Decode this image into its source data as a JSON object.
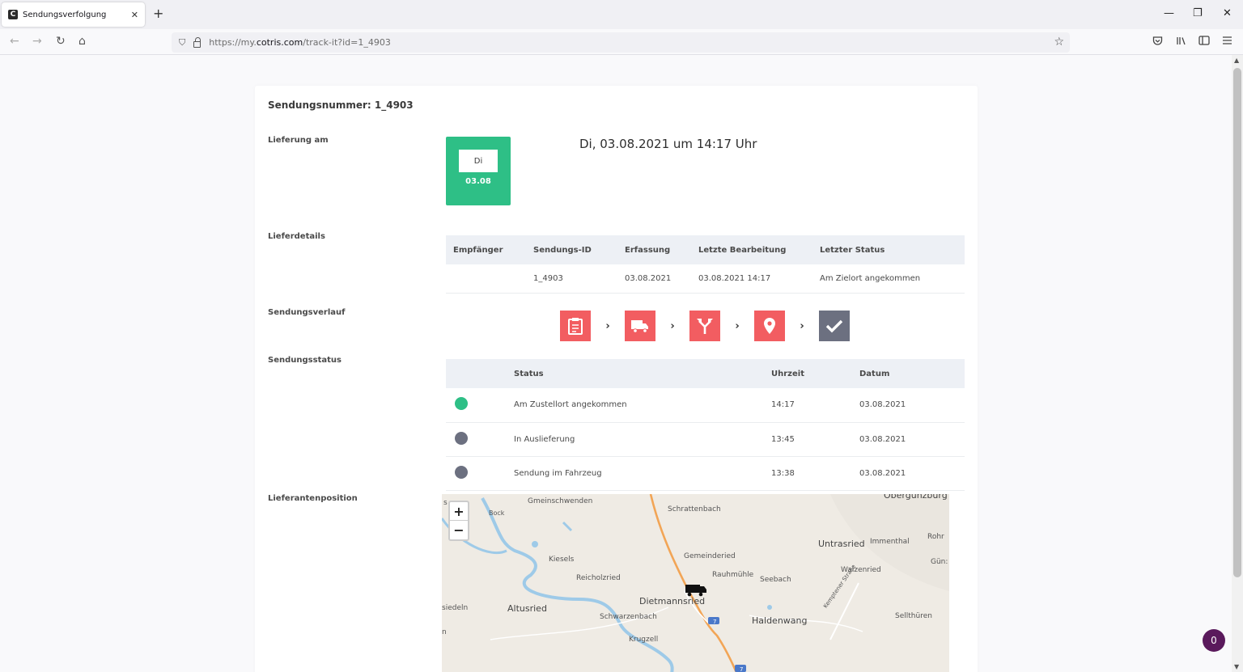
{
  "browser": {
    "tab_title": "Sendungsverfolgung",
    "tab_close": "✕",
    "new_tab": "+",
    "url_prefix": "https://my.",
    "url_domain": "cotris.com",
    "url_path": "/track-it?id=1_4903",
    "window_controls": {
      "minimize": "—",
      "restore": "❐",
      "close": "✕"
    },
    "nav": {
      "back": "←",
      "forward": "→",
      "reload": "↻",
      "home": "⌂"
    }
  },
  "page": {
    "heading_label": "Sendungsnummer:",
    "shipment_number": "1_4903",
    "delivery": {
      "label": "Lieferung am",
      "day_short": "Di",
      "date_short": "03.08",
      "full_text": "Di, 03.08.2021 um 14:17 Uhr"
    },
    "details": {
      "label": "Lieferdetails",
      "columns": [
        "Empfänger",
        "Sendungs-ID",
        "Erfassung",
        "Letzte Bearbeitung",
        "Letzter Status"
      ],
      "row": [
        "",
        "1_4903",
        "03.08.2021",
        "03.08.2021 14:17",
        "Am Zielort angekommen"
      ]
    },
    "history": {
      "label": "Sendungsverlauf",
      "steps": [
        {
          "icon": "clipboard-icon",
          "state": "done"
        },
        {
          "icon": "truck-icon",
          "state": "done"
        },
        {
          "icon": "route-split-icon",
          "state": "done"
        },
        {
          "icon": "location-pin-icon",
          "state": "done"
        },
        {
          "icon": "checkmark-icon",
          "state": "pending"
        }
      ],
      "arrow": "›"
    },
    "status": {
      "label": "Sendungsstatus",
      "columns": [
        "",
        "Status",
        "Uhrzeit",
        "Datum"
      ],
      "rows": [
        {
          "color": "#2ebf86",
          "status": "Am Zustellort angekommen",
          "time": "14:17",
          "date": "03.08.2021"
        },
        {
          "color": "#6c7080",
          "status": "In Auslieferung",
          "time": "13:45",
          "date": "03.08.2021"
        },
        {
          "color": "#6c7080",
          "status": "Sendung im Fahrzeug",
          "time": "13:38",
          "date": "03.08.2021"
        }
      ]
    },
    "position": {
      "label": "Lieferantenposition",
      "zoom_in": "+",
      "zoom_out": "−",
      "places": {
        "gmeinschwenden": "Gmeinschwenden",
        "schrattenbach": "Schrattenbach",
        "obergunzburg": "Obergünzburg",
        "rohr": "Rohr",
        "untrasried": "Untrasried",
        "immenthal": "Immenthal",
        "guen": "Gün:",
        "kiesels": "Kiesels",
        "gemeinderied": "Gemeinderied",
        "reicholzried": "Reicholzried",
        "rauhmuehle": "Rauhmühle",
        "seebach": "Seebach",
        "waizenried": "Waizenried",
        "siedeln": "siedeln",
        "altusried": "Altusried",
        "dietmannsried": "Dietmannsried",
        "schwarzenbach": "Schwarzenbach",
        "haldenwang": "Haldenwang",
        "kemptener": "Kemptener Straße",
        "sellthueren": "Sellthüren",
        "krugzell": "Krugzell",
        "bock": "Bock",
        "s": "s",
        "n": "n"
      },
      "road_label": "7"
    },
    "chat_count": "0"
  },
  "colors": {
    "success": "#2ebf86",
    "step_active": "#f25d61",
    "step_pending": "#6c7080",
    "header_bg": "#edf0f5"
  }
}
